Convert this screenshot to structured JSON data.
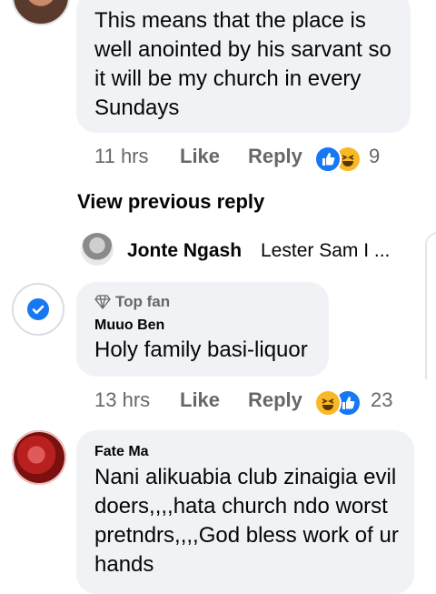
{
  "comments": [
    {
      "text": "This means that the place is well anointed by his sarvant so it will be my church in every Sundays",
      "time": "11 hrs",
      "like_label": "Like",
      "reply_label": "Reply",
      "reaction_count": "9",
      "reactions": [
        "like-icon",
        "haha-icon"
      ]
    },
    {
      "badge": "Top fan",
      "author": "Muuo Ben",
      "text": "Holy family basi-liquor",
      "time": "13 hrs",
      "like_label": "Like",
      "reply_label": "Reply",
      "reaction_count": "23",
      "reactions": [
        "haha-icon",
        "like-icon"
      ]
    },
    {
      "author": "Fate Ma",
      "text": "Nani alikuabia club zinaigia evil doers,,,,hata church ndo worst pretndrs,,,,God bless work of ur hands"
    }
  ],
  "view_previous_reply": "View previous reply",
  "reply_preview": {
    "author": "Jonte Ngash",
    "snippet": "Lester Sam I ..."
  },
  "colors": {
    "bubble": "#f0f2f5",
    "meta": "#65676b",
    "like_blue": "#1877f2",
    "haha_yellow": "#f7b928"
  }
}
